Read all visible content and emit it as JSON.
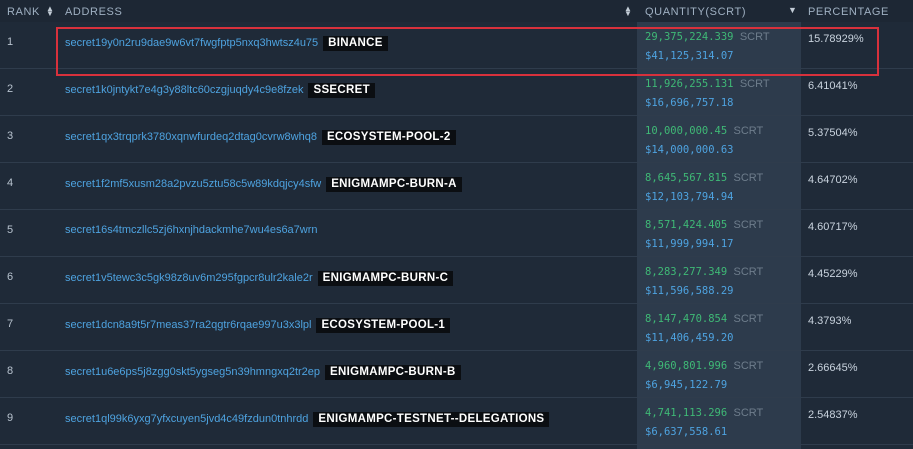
{
  "header": {
    "rank": "RANK",
    "address": "ADDRESS",
    "quantity": "QUANTITY(SCRT)",
    "percentage": "PERCENTAGE"
  },
  "rows": [
    {
      "rank": "1",
      "address": "secret19y0n2ru9dae9w6vt7fwgfptp5nxq3hwtsz4u75",
      "tag": "BINANCE",
      "qty": "29,375,224.339",
      "unit": "SCRT",
      "usd": "$41,125,314.07",
      "pct": "15.78929%"
    },
    {
      "rank": "2",
      "address": "secret1k0jntykt7e4g3y88ltc60czgjuqdy4c9e8fzek",
      "tag": "SSECRET",
      "qty": "11,926,255.131",
      "unit": "SCRT",
      "usd": "$16,696,757.18",
      "pct": "6.41041%"
    },
    {
      "rank": "3",
      "address": "secret1qx3trqprk3780xqnwfurdeq2dtag0cvrw8whq8",
      "tag": "ECOSYSTEM-POOL-2",
      "qty": "10,000,000.45",
      "unit": "SCRT",
      "usd": "$14,000,000.63",
      "pct": "5.37504%"
    },
    {
      "rank": "4",
      "address": "secret1f2mf5xusm28a2pvzu5ztu58c5w89kdqjcy4sfw",
      "tag": "ENIGMAMPC-BURN-A",
      "qty": "8,645,567.815",
      "unit": "SCRT",
      "usd": "$12,103,794.94",
      "pct": "4.64702%"
    },
    {
      "rank": "5",
      "address": "secret16s4tmczllc5zj6hxnjhdackmhe7wu4es6a7wrn",
      "tag": "",
      "qty": "8,571,424.405",
      "unit": "SCRT",
      "usd": "$11,999,994.17",
      "pct": "4.60717%"
    },
    {
      "rank": "6",
      "address": "secret1v5tewc3c5gk98z8uv6m295fgpcr8ulr2kale2r",
      "tag": "ENIGMAMPC-BURN-C",
      "qty": "8,283,277.349",
      "unit": "SCRT",
      "usd": "$11,596,588.29",
      "pct": "4.45229%"
    },
    {
      "rank": "7",
      "address": "secret1dcn8a9t5r7meas37ra2qgtr6rqae997u3x3lpl",
      "tag": "ECOSYSTEM-POOL-1",
      "qty": "8,147,470.854",
      "unit": "SCRT",
      "usd": "$11,406,459.20",
      "pct": "4.3793%"
    },
    {
      "rank": "8",
      "address": "secret1u6e6ps5j8zgg0skt5ygseg5n39hmngxq2tr2ep",
      "tag": "ENIGMAMPC-BURN-B",
      "qty": "4,960,801.996",
      "unit": "SCRT",
      "usd": "$6,945,122.79",
      "pct": "2.66645%"
    },
    {
      "rank": "9",
      "address": "secret1ql99k6yxg7yfxcuyen5jvd4c49fzdun0tnhrdd",
      "tag": "ENIGMAMPC-TESTNET--DELEGATIONS",
      "qty": "4,741,113.296",
      "unit": "SCRT",
      "usd": "$6,637,558.61",
      "pct": "2.54837%"
    }
  ],
  "colors": {
    "background": "#1f2a38",
    "address_link": "#4ea3e0",
    "quantity_green": "#3fb976",
    "highlight_red": "#d8313c",
    "tag_bg": "#0b0e12"
  },
  "icons": [
    "sort-updown-icon",
    "sort-down-icon"
  ]
}
